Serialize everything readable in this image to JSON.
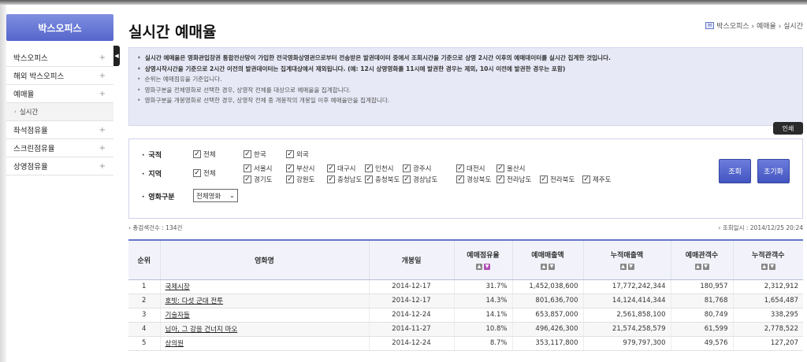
{
  "sidebar": {
    "title": "박스오피스",
    "items": [
      {
        "label": "박스오피스",
        "icon": "+"
      },
      {
        "label": "해외 박스오피스",
        "icon": "+"
      },
      {
        "label": "예매율",
        "icon": "+"
      },
      {
        "label": "실시간",
        "sub": true
      },
      {
        "label": "좌석점유율",
        "icon": "+"
      },
      {
        "label": "스크린점유율",
        "icon": "+"
      },
      {
        "label": "상영점유율",
        "icon": "+"
      }
    ],
    "collapse_icon": "◀"
  },
  "page": {
    "title": "실시간 예매율",
    "breadcrumb": {
      "home_icon": "H",
      "text": "박스오피스 › 예매율 › 실시간"
    }
  },
  "notice": [
    "실시간 예매율은 영화관입장권 통합전산망이 가입한 전국영화상영관으로부터 전송받은 발권데이터 중에서 조회시간을 기준으로 상영 2시간 이후의 예매데이터를 실시간 집계한 것입니다.",
    "상영시작시간을 기준으로 2시간 이전의 발권데이터는 집계대상에서 제외됩니다. (예: 12시 상영영화를 11시에 발권한 경우는 제외, 10시 이전에 발권한 경우는 포함)",
    "순위는 예매점유율 기준입니다.",
    "영화구분을 전체영화로 선택한 경우, 상영작 전체를 대상으로 예매율을 집계합니다.",
    "영화구분을 개봉영화로 선택한 경우, 상영작 전체 중 개봉작의 개봉일 이후 예매율만을 집계합니다."
  ],
  "print_label": "인쇄",
  "filters": {
    "nation_label": "국적",
    "nation_options": [
      "전체",
      "한국",
      "외국"
    ],
    "region_label": "지역",
    "region_all": "전체",
    "regions_row1": [
      "서울시",
      "부산시",
      "대구시",
      "인천시",
      "광주시",
      "대전시",
      "울산시"
    ],
    "regions_row2": [
      "경기도",
      "강원도",
      "충청남도",
      "충청북도",
      "경상남도",
      "경상북도",
      "전라남도",
      "전라북도",
      "제주도"
    ],
    "movie_type_label": "영화구분",
    "movie_type_value": "전체영화",
    "search_label": "조회",
    "reset_label": "초기화"
  },
  "stats": {
    "total": "총검색건수 : 134건",
    "time": "조회일시 : 2014/12/25 20:24"
  },
  "table": {
    "headers": [
      "순위",
      "영화명",
      "개봉일",
      "예매점유율",
      "예매매출액",
      "누적매출액",
      "예매관객수",
      "누적관객수"
    ],
    "rows": [
      [
        "1",
        "국제시장",
        "2014-12-17",
        "31.7%",
        "1,452,038,600",
        "17,772,242,344",
        "180,957",
        "2,312,912"
      ],
      [
        "2",
        "호빗: 다섯 군대 전투",
        "2014-12-17",
        "14.3%",
        "801,636,700",
        "14,124,414,344",
        "81,768",
        "1,654,487"
      ],
      [
        "3",
        "기술자들",
        "2014-12-24",
        "14.1%",
        "653,857,000",
        "2,561,858,100",
        "80,749",
        "338,295"
      ],
      [
        "4",
        "님아, 그 강을 건너지 마오",
        "2014-11-27",
        "10.8%",
        "496,426,300",
        "21,574,258,579",
        "61,599",
        "2,778,522"
      ],
      [
        "5",
        "상의원",
        "2014-12-24",
        "8.7%",
        "353,117,800",
        "979,797,300",
        "49,576",
        "127,207"
      ]
    ]
  },
  "colors": {
    "accent": "#5566cc",
    "notice_bg": "#e7e9f6",
    "sort_active": "#b14fb6"
  }
}
